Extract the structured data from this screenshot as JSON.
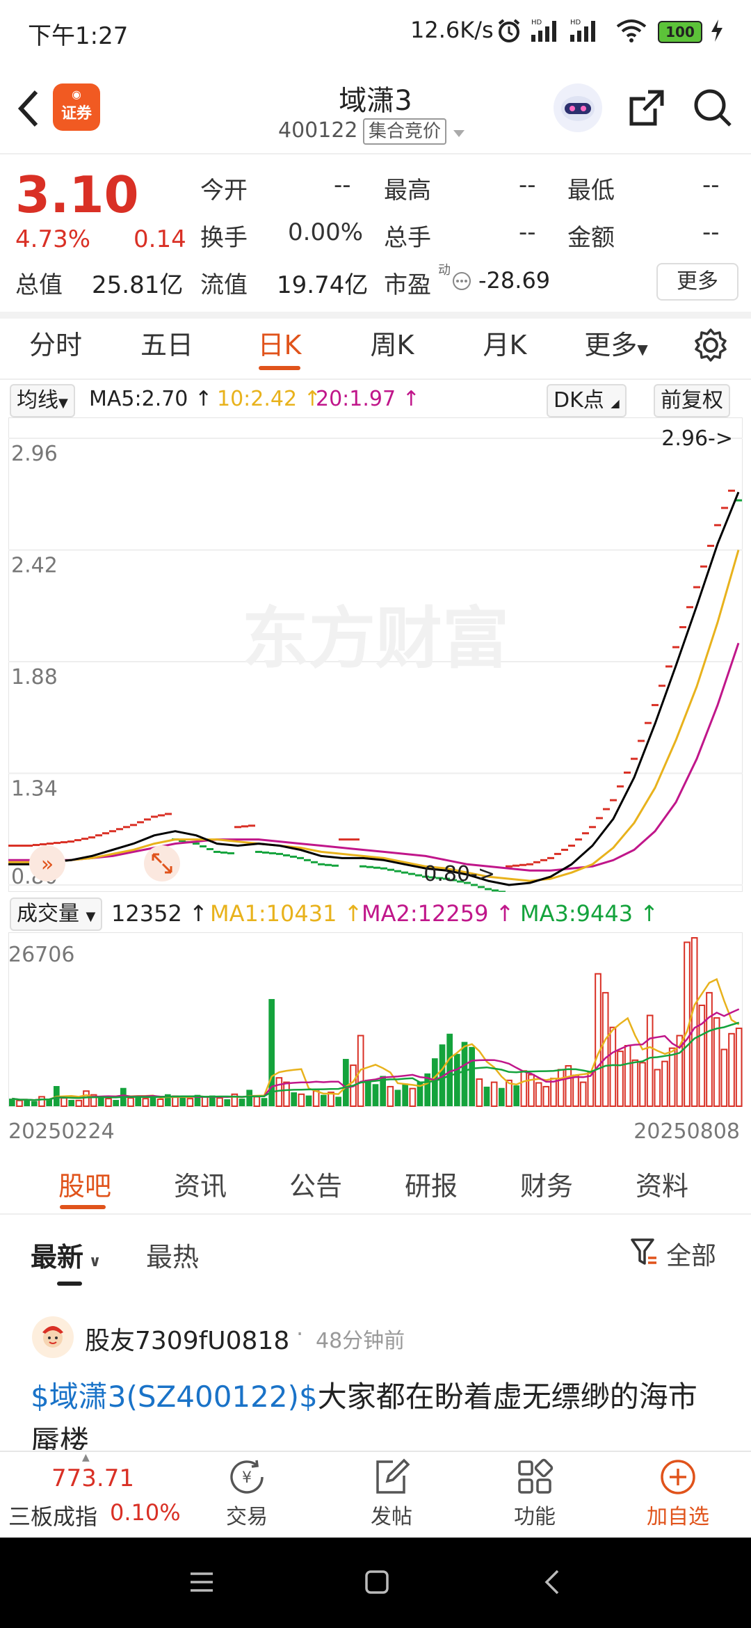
{
  "status_bar": {
    "time": "下午1:27",
    "network_speed": "12.6K/s",
    "battery": "100"
  },
  "header": {
    "logo_text": "证券",
    "title": "域潇3",
    "code": "400122",
    "trade_mode": "集合竞价"
  },
  "quote": {
    "price": "3.10",
    "change_pct": "4.73%",
    "change_amt": "0.14",
    "fields": [
      {
        "label": "今开",
        "value": "--"
      },
      {
        "label": "最高",
        "value": "--"
      },
      {
        "label": "最低",
        "value": "--"
      },
      {
        "label": "换手",
        "value": "0.00%"
      },
      {
        "label": "总手",
        "value": "--"
      },
      {
        "label": "金额",
        "value": "--"
      }
    ],
    "total_value_label": "总值",
    "total_value": "25.81亿",
    "float_value_label": "流值",
    "float_value": "19.74亿",
    "pe_label": "市盈",
    "pe_sup": "动",
    "pe_value": "-28.69",
    "more_button": "更多"
  },
  "period_tabs": [
    "分时",
    "五日",
    "日K",
    "周K",
    "月K",
    "更多"
  ],
  "active_period": "日K",
  "chart_toolbar": {
    "ma_selector": "均线",
    "ma5": "MA5:2.70",
    "ma10": "10:2.42",
    "ma20": "20:1.97",
    "dk_button": "DK点",
    "adjust_button": "前复权"
  },
  "volume_toolbar": {
    "selector": "成交量",
    "volume": "12352",
    "ma1": "MA1:10431",
    "ma2": "MA2:12259",
    "ma3": "MA3:9443"
  },
  "colors": {
    "up": "#d93025",
    "down": "#14a33c",
    "accent": "#e0531b",
    "ma5": "#000000",
    "ma10": "#e8b21c",
    "ma20": "#c0168a",
    "link_blue": "#1a73c8"
  },
  "watermark": "东方财富",
  "chart_data": {
    "type": "line",
    "x_start_label": "20250224",
    "x_end_label": "20250808",
    "y_tick_labels": [
      "2.96",
      "2.42",
      "1.88",
      "1.34",
      "0.80"
    ],
    "ylim": [
      0.8,
      2.96
    ],
    "max_marker": "2.96->",
    "min_marker": "0.80->",
    "series": [
      {
        "name": "MA5",
        "values": [
          0.9,
          0.9,
          0.91,
          0.92,
          0.94,
          0.97,
          1.0,
          1.04,
          1.06,
          1.04,
          1.0,
          0.99,
          1.0,
          0.99,
          0.97,
          0.94,
          0.93,
          0.93,
          0.92,
          0.9,
          0.88,
          0.87,
          0.85,
          0.82,
          0.8,
          0.81,
          0.84,
          0.9,
          0.99,
          1.12,
          1.32,
          1.58,
          1.86,
          2.15,
          2.45,
          2.7
        ]
      },
      {
        "name": "MA10",
        "values": [
          0.91,
          0.91,
          0.91,
          0.92,
          0.93,
          0.95,
          0.97,
          1.0,
          1.02,
          1.02,
          1.02,
          1.01,
          1.0,
          0.99,
          0.98,
          0.96,
          0.95,
          0.94,
          0.93,
          0.91,
          0.89,
          0.88,
          0.86,
          0.84,
          0.83,
          0.82,
          0.83,
          0.86,
          0.9,
          0.98,
          1.1,
          1.27,
          1.5,
          1.76,
          2.07,
          2.42
        ]
      },
      {
        "name": "MA20",
        "values": [
          0.92,
          0.92,
          0.92,
          0.92,
          0.93,
          0.94,
          0.96,
          0.98,
          1.0,
          1.01,
          1.02,
          1.02,
          1.02,
          1.01,
          1.0,
          0.99,
          0.98,
          0.97,
          0.96,
          0.95,
          0.94,
          0.92,
          0.9,
          0.89,
          0.88,
          0.87,
          0.87,
          0.88,
          0.89,
          0.92,
          0.97,
          1.06,
          1.2,
          1.41,
          1.67,
          1.97
        ]
      }
    ],
    "volume": {
      "y_top_label": "26706",
      "bars": [
        {
          "v": 1200,
          "up": false
        },
        {
          "v": 900,
          "up": true
        },
        {
          "v": 1000,
          "up": false
        },
        {
          "v": 800,
          "up": false
        },
        {
          "v": 1500,
          "up": true
        },
        {
          "v": 1100,
          "up": false
        },
        {
          "v": 3200,
          "up": false
        },
        {
          "v": 1300,
          "up": true
        },
        {
          "v": 1000,
          "up": false
        },
        {
          "v": 900,
          "up": true
        },
        {
          "v": 2400,
          "up": true
        },
        {
          "v": 1800,
          "up": true
        },
        {
          "v": 1500,
          "up": false
        },
        {
          "v": 1200,
          "up": true
        },
        {
          "v": 1000,
          "up": false
        },
        {
          "v": 2900,
          "up": false
        },
        {
          "v": 1300,
          "up": true
        },
        {
          "v": 1700,
          "up": false
        },
        {
          "v": 1200,
          "up": true
        },
        {
          "v": 1400,
          "up": false
        },
        {
          "v": 1100,
          "up": true
        },
        {
          "v": 1900,
          "up": false
        },
        {
          "v": 1600,
          "up": true
        },
        {
          "v": 1400,
          "up": false
        },
        {
          "v": 1200,
          "up": true
        },
        {
          "v": 1800,
          "up": false
        },
        {
          "v": 1500,
          "up": true
        },
        {
          "v": 1700,
          "up": false
        },
        {
          "v": 1300,
          "up": true
        },
        {
          "v": 1100,
          "up": false
        },
        {
          "v": 1900,
          "up": true
        },
        {
          "v": 1200,
          "up": false
        },
        {
          "v": 2600,
          "up": false
        },
        {
          "v": 1500,
          "up": true
        },
        {
          "v": 1300,
          "up": false
        },
        {
          "v": 17000,
          "up": false
        },
        {
          "v": 4500,
          "up": true
        },
        {
          "v": 3800,
          "up": true
        },
        {
          "v": 2200,
          "up": false
        },
        {
          "v": 1900,
          "up": true
        },
        {
          "v": 1700,
          "up": false
        },
        {
          "v": 2400,
          "up": true
        },
        {
          "v": 1800,
          "up": false
        },
        {
          "v": 2200,
          "up": true
        },
        {
          "v": 1500,
          "up": false
        },
        {
          "v": 7500,
          "up": false
        },
        {
          "v": 6500,
          "up": true
        },
        {
          "v": 11200,
          "up": true
        },
        {
          "v": 4200,
          "up": false
        },
        {
          "v": 3500,
          "up": false
        },
        {
          "v": 4800,
          "up": false
        },
        {
          "v": 3100,
          "up": true
        },
        {
          "v": 2600,
          "up": false
        },
        {
          "v": 3600,
          "up": false
        },
        {
          "v": 2800,
          "up": true
        },
        {
          "v": 3900,
          "up": false
        },
        {
          "v": 5200,
          "up": false
        },
        {
          "v": 7600,
          "up": false
        },
        {
          "v": 9800,
          "up": false
        },
        {
          "v": 11500,
          "up": false
        },
        {
          "v": 8300,
          "up": false
        },
        {
          "v": 10200,
          "up": false
        },
        {
          "v": 9400,
          "up": false
        },
        {
          "v": 4300,
          "up": true
        },
        {
          "v": 3100,
          "up": false
        },
        {
          "v": 3800,
          "up": true
        },
        {
          "v": 2900,
          "up": false
        },
        {
          "v": 4100,
          "up": true
        },
        {
          "v": 3300,
          "up": false
        },
        {
          "v": 5600,
          "up": true
        },
        {
          "v": 5000,
          "up": true
        },
        {
          "v": 3700,
          "up": true
        },
        {
          "v": 3100,
          "up": true
        },
        {
          "v": 4400,
          "up": true
        },
        {
          "v": 5800,
          "up": true
        },
        {
          "v": 6400,
          "up": true
        },
        {
          "v": 4900,
          "up": true
        },
        {
          "v": 3800,
          "up": true
        },
        {
          "v": 5300,
          "up": true
        },
        {
          "v": 21000,
          "up": true
        },
        {
          "v": 18000,
          "up": true
        },
        {
          "v": 12500,
          "up": true
        },
        {
          "v": 8700,
          "up": true
        },
        {
          "v": 9600,
          "up": true
        },
        {
          "v": 7300,
          "up": true
        },
        {
          "v": 6900,
          "up": true
        },
        {
          "v": 14400,
          "up": true
        },
        {
          "v": 5800,
          "up": true
        },
        {
          "v": 7100,
          "up": true
        },
        {
          "v": 9200,
          "up": true
        },
        {
          "v": 11200,
          "up": true
        },
        {
          "v": 26000,
          "up": true
        },
        {
          "v": 26706,
          "up": true
        },
        {
          "v": 16000,
          "up": true
        },
        {
          "v": 18000,
          "up": true
        },
        {
          "v": 14000,
          "up": true
        },
        {
          "v": 9000,
          "up": true
        },
        {
          "v": 11500,
          "up": true
        },
        {
          "v": 12352,
          "up": true
        }
      ]
    }
  },
  "content_tabs": [
    "股吧",
    "资讯",
    "公告",
    "研报",
    "财务",
    "资料"
  ],
  "active_content_tab": "股吧",
  "sort_tabs": {
    "latest": "最新",
    "hot": "最热",
    "filter": "全部"
  },
  "post": {
    "author": "股友7309fU0818",
    "time": "48分钟前",
    "stock_link": "$域潇3(SZ400122)$",
    "text": "大家都在盼着虚无缥缈的海市蜃楼"
  },
  "bottom_nav": {
    "index_value": "773.71",
    "index_name": "三板成指",
    "index_change": "0.10%",
    "items": [
      "交易",
      "发帖",
      "功能",
      "加自选"
    ]
  }
}
